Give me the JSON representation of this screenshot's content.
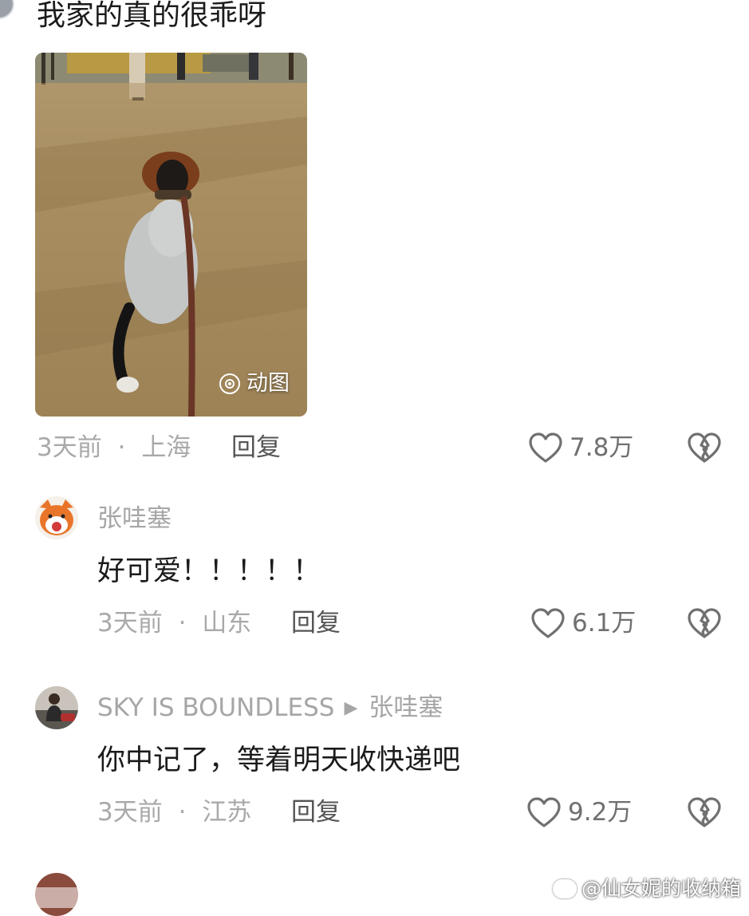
{
  "top_comment": {
    "text": "我家的真的很乖呀",
    "media_badge": "动图",
    "time": "3天前",
    "location": "上海",
    "separator": "·",
    "reply_label": "回复",
    "likes": "7.8万"
  },
  "replies": [
    {
      "username": "张哇塞",
      "text": "好可爱！！！！！",
      "time": "3天前",
      "separator": "·",
      "location": "山东",
      "reply_label": "回复",
      "likes": "6.1万",
      "avatar_icon": "fox-avatar-icon"
    },
    {
      "username": "SKY IS BOUNDLESS",
      "reply_to": "张哇塞",
      "text": "你中记了，等着明天收快递吧",
      "time": "3天前",
      "separator": "·",
      "location": "江苏",
      "reply_label": "回复",
      "likes": "9.2万",
      "avatar_icon": "photo-avatar-icon"
    }
  ],
  "watermark": "@仙女妮的收纳箱",
  "colors": {
    "meta_gray": "#a9a9a9",
    "text_dark": "#1b1b1b",
    "icon_gray": "#707070"
  }
}
